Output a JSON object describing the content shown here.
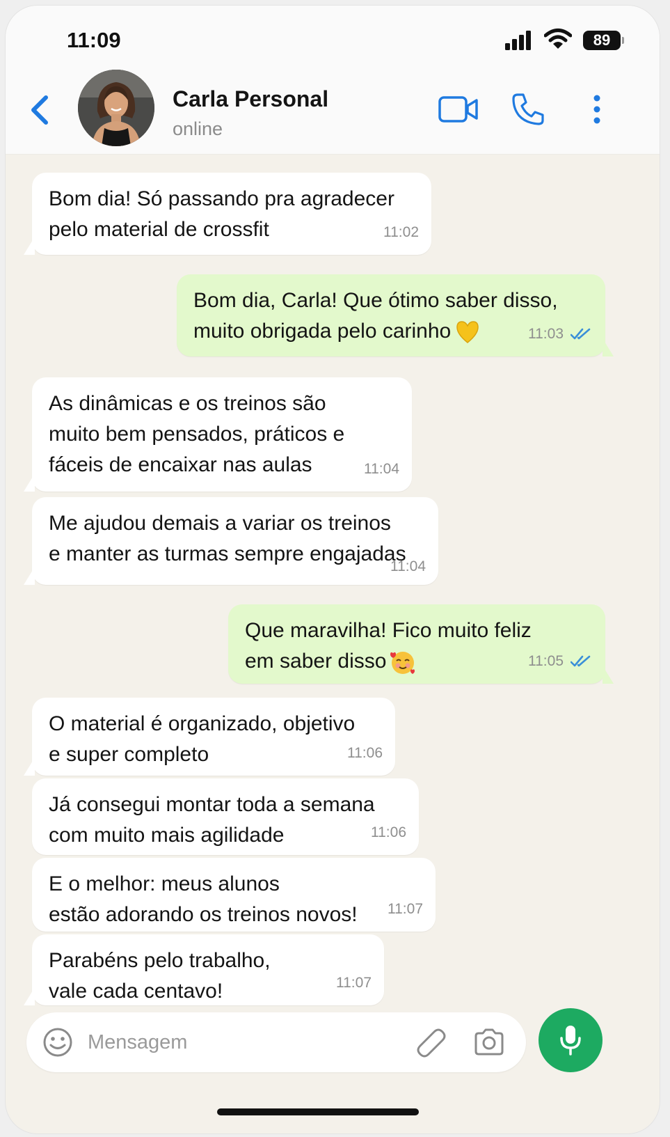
{
  "status_bar": {
    "time": "11:09",
    "battery": "89"
  },
  "header": {
    "contact_name": "Carla Personal",
    "contact_status": "online"
  },
  "messages": [
    {
      "direction": "in",
      "text": "Bom dia! Só passando pra agradecer\npelo material de crossfit",
      "time": "11:02"
    },
    {
      "direction": "out",
      "text": "Bom dia, Carla! Que ótimo saber disso,\nmuito obrigada pelo carinho",
      "emoji": "yellow-heart",
      "time": "11:03",
      "read": true
    },
    {
      "direction": "in",
      "text": "As dinâmicas e os treinos são\nmuito bem pensados, práticos e\nfáceis de encaixar nas aulas",
      "time": "11:04"
    },
    {
      "direction": "in",
      "text": "Me ajudou demais a variar os treinos\ne manter as turmas sempre engajadas",
      "time": "11:04"
    },
    {
      "direction": "out",
      "text": "Que maravilha! Fico muito feliz\nem saber disso",
      "emoji": "smiling-face-with-hearts",
      "time": "11:05",
      "read": true
    },
    {
      "direction": "in",
      "text": "O material é organizado, objetivo\ne super completo",
      "time": "11:06"
    },
    {
      "direction": "in",
      "text": "Já consegui montar toda a semana\ncom muito mais agilidade",
      "time": "11:06"
    },
    {
      "direction": "in",
      "text": "E o melhor: meus alunos\nestão adorando os treinos novos!",
      "time": "11:07"
    },
    {
      "direction": "in",
      "text": "Parabéns pelo trabalho,\nvale cada centavo!",
      "time": "11:07"
    }
  ],
  "composer": {
    "placeholder": "Mensagem"
  },
  "colors": {
    "accent_blue": "#1f7ae0",
    "incoming_bubble": "#ffffff",
    "outgoing_bubble": "#e3f9cc",
    "chat_background": "#f4f1ea",
    "mic_button": "#1daa61",
    "read_ticks": "#3a8fd8"
  },
  "icons": [
    "back-chevron-icon",
    "video-call-icon",
    "voice-call-icon",
    "more-options-icon",
    "emoji-icon",
    "attach-icon",
    "camera-icon",
    "mic-icon"
  ]
}
